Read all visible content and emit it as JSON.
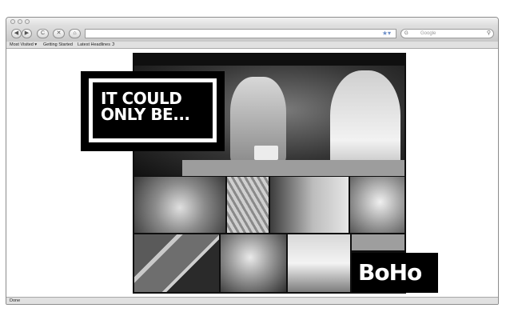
{
  "browser": {
    "search_engine": "G",
    "search_placeholder": "Google",
    "bookmarks": [
      "Most Visited ▾",
      "Getting Started",
      "Latest Headlines ℑ"
    ],
    "status": "Done",
    "nav": {
      "back": "◀",
      "forward": "▶",
      "reload": "C",
      "stop": "✕",
      "home": "⌂"
    }
  },
  "page": {
    "tagline": "IT COULD ONLY BE...",
    "brand": "BoHo"
  },
  "colors": {
    "background": "#ffffff",
    "panel": "#000000",
    "text_on_panel": "#ffffff"
  }
}
